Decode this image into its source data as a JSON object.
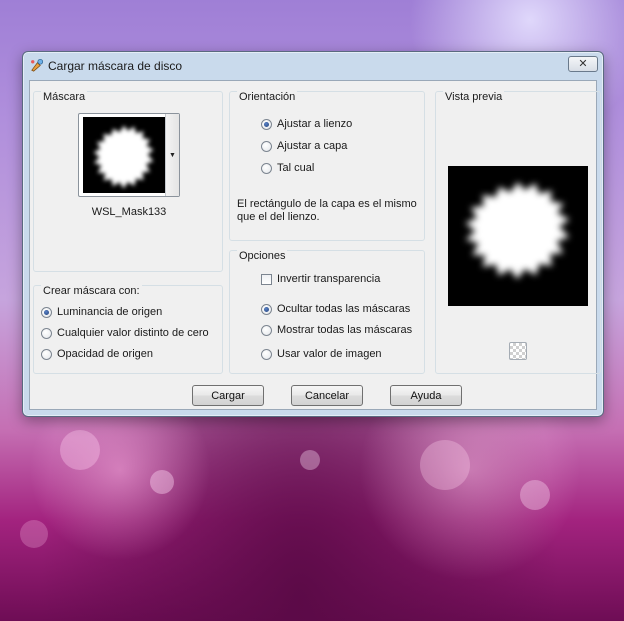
{
  "window": {
    "title": "Cargar máscara de disco",
    "close_glyph": "✕",
    "title_icon": "paint-icon"
  },
  "mask_group": {
    "title": "Máscara",
    "mask_name": "WSL_Mask133",
    "dropdown_glyph": "▼"
  },
  "create_group": {
    "title": "Crear máscara con:",
    "options": [
      "Luminancia de origen",
      "Cualquier valor distinto de cero",
      "Opacidad de origen"
    ],
    "selected": 0
  },
  "orientation_group": {
    "title": "Orientación",
    "options": [
      "Ajustar a lienzo",
      "Ajustar a capa",
      "Tal cual"
    ],
    "selected": 0,
    "description": "El rectángulo de la capa es el mismo que el del lienzo."
  },
  "options_group": {
    "title": "Opciones",
    "invert_label": "Invertir transparencia",
    "invert_checked": false,
    "options": [
      "Ocultar todas las máscaras",
      "Mostrar todas las máscaras",
      "Usar valor de imagen"
    ],
    "selected": 0
  },
  "preview_group": {
    "title": "Vista previa",
    "icon": "transparency-checker-icon"
  },
  "buttons": {
    "load": "Cargar",
    "cancel": "Cancelar",
    "help": "Ayuda"
  },
  "colors": {
    "dialog_frame": "#c9daec",
    "client_bg": "#f0f0f0",
    "radio_selected": "#1f3e78"
  }
}
